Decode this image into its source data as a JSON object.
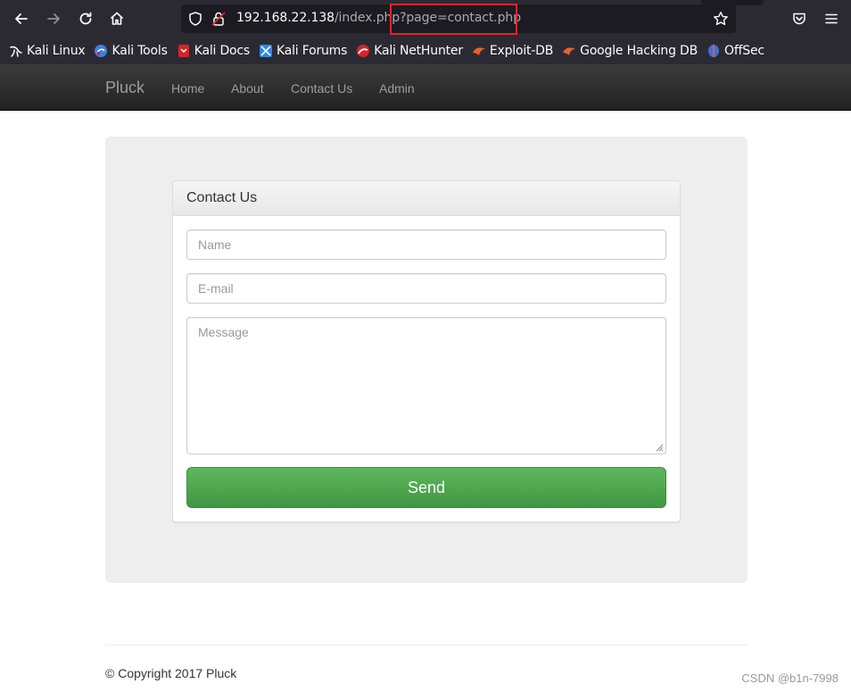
{
  "browser": {
    "url_host": "192.168.22.138",
    "url_path": "/index.php",
    "url_query": "?page=contact.php"
  },
  "bookmarks": [
    {
      "label": "Kali Linux",
      "icon": "kali-dragon-icon",
      "color": "#ffffff"
    },
    {
      "label": "Kali Tools",
      "icon": "kali-tools-icon",
      "color": "#3d7fe0"
    },
    {
      "label": "Kali Docs",
      "icon": "kali-docs-icon",
      "color": "#d7232a"
    },
    {
      "label": "Kali Forums",
      "icon": "kali-forums-icon",
      "color": "#2f86e6"
    },
    {
      "label": "Kali NetHunter",
      "icon": "nethunter-icon",
      "color": "#d7232a"
    },
    {
      "label": "Exploit-DB",
      "icon": "exploit-db-icon",
      "color": "#e8622b"
    },
    {
      "label": "Google Hacking DB",
      "icon": "ghdb-icon",
      "color": "#e8622b"
    },
    {
      "label": "OffSec",
      "icon": "offsec-icon",
      "color": "#3b6fd8"
    }
  ],
  "site": {
    "brand": "Pluck",
    "nav": [
      "Home",
      "About",
      "Contact Us",
      "Admin"
    ]
  },
  "contact_form": {
    "title": "Contact Us",
    "name_placeholder": "Name",
    "email_placeholder": "E-mail",
    "message_placeholder": "Message",
    "send_label": "Send"
  },
  "footer": {
    "copyright": "© Copyright 2017 Pluck"
  },
  "watermark": "CSDN @b1n-7998",
  "colors": {
    "send_button": "#5cb85c",
    "highlight_box": "#e0242e"
  }
}
